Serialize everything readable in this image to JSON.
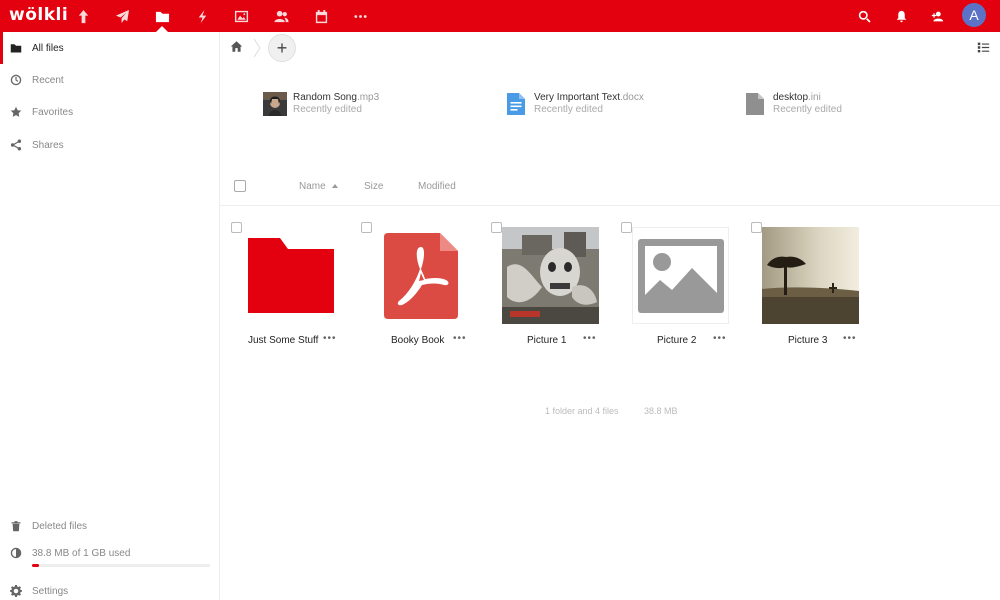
{
  "header": {
    "logo": "wölkli",
    "apps": [
      {
        "icon": "upload-icon"
      },
      {
        "icon": "send-icon"
      },
      {
        "icon": "folder-icon",
        "active": true
      },
      {
        "icon": "activity-icon"
      },
      {
        "icon": "gallery-icon"
      },
      {
        "icon": "contacts-icon"
      },
      {
        "icon": "calendar-icon"
      },
      {
        "icon": "more-apps-icon"
      }
    ],
    "right_icons": [
      "search-icon",
      "notifications-icon",
      "contacts-menu-icon"
    ],
    "avatar_letter": "A",
    "accent_color": "#e3000f"
  },
  "sidebar": {
    "items": [
      {
        "label": "All files",
        "icon": "folder-icon",
        "active": true
      },
      {
        "label": "Recent",
        "icon": "clock-icon"
      },
      {
        "label": "Favorites",
        "icon": "star-icon"
      },
      {
        "label": "Shares",
        "icon": "share-icon"
      }
    ],
    "deleted_files": "Deleted files",
    "quota": {
      "label": "38.8 MB of 1 GB used",
      "fraction": 0.038
    },
    "settings": "Settings"
  },
  "recent_files": [
    {
      "name": "Random Song",
      "ext": ".mp3",
      "status": "Recently edited",
      "icon": "album-art-thumbnail"
    },
    {
      "name": "Very Important Text",
      "ext": ".docx",
      "status": "Recently edited",
      "icon": "document-icon"
    },
    {
      "name": "desktop",
      "ext": ".ini",
      "status": "Recently edited",
      "icon": "file-icon"
    }
  ],
  "list_header": {
    "name": "Name",
    "size": "Size",
    "modified": "Modified"
  },
  "files": [
    {
      "label": "Just Some Stuff",
      "type": "folder"
    },
    {
      "label": "Booky Book",
      "type": "pdf"
    },
    {
      "label": "Picture 1",
      "type": "image"
    },
    {
      "label": "Picture 2",
      "type": "image-placeholder"
    },
    {
      "label": "Picture 3",
      "type": "image"
    }
  ],
  "more_label": "•••",
  "summary": {
    "counts": "1 folder and 4 files",
    "size": "38.8 MB"
  }
}
